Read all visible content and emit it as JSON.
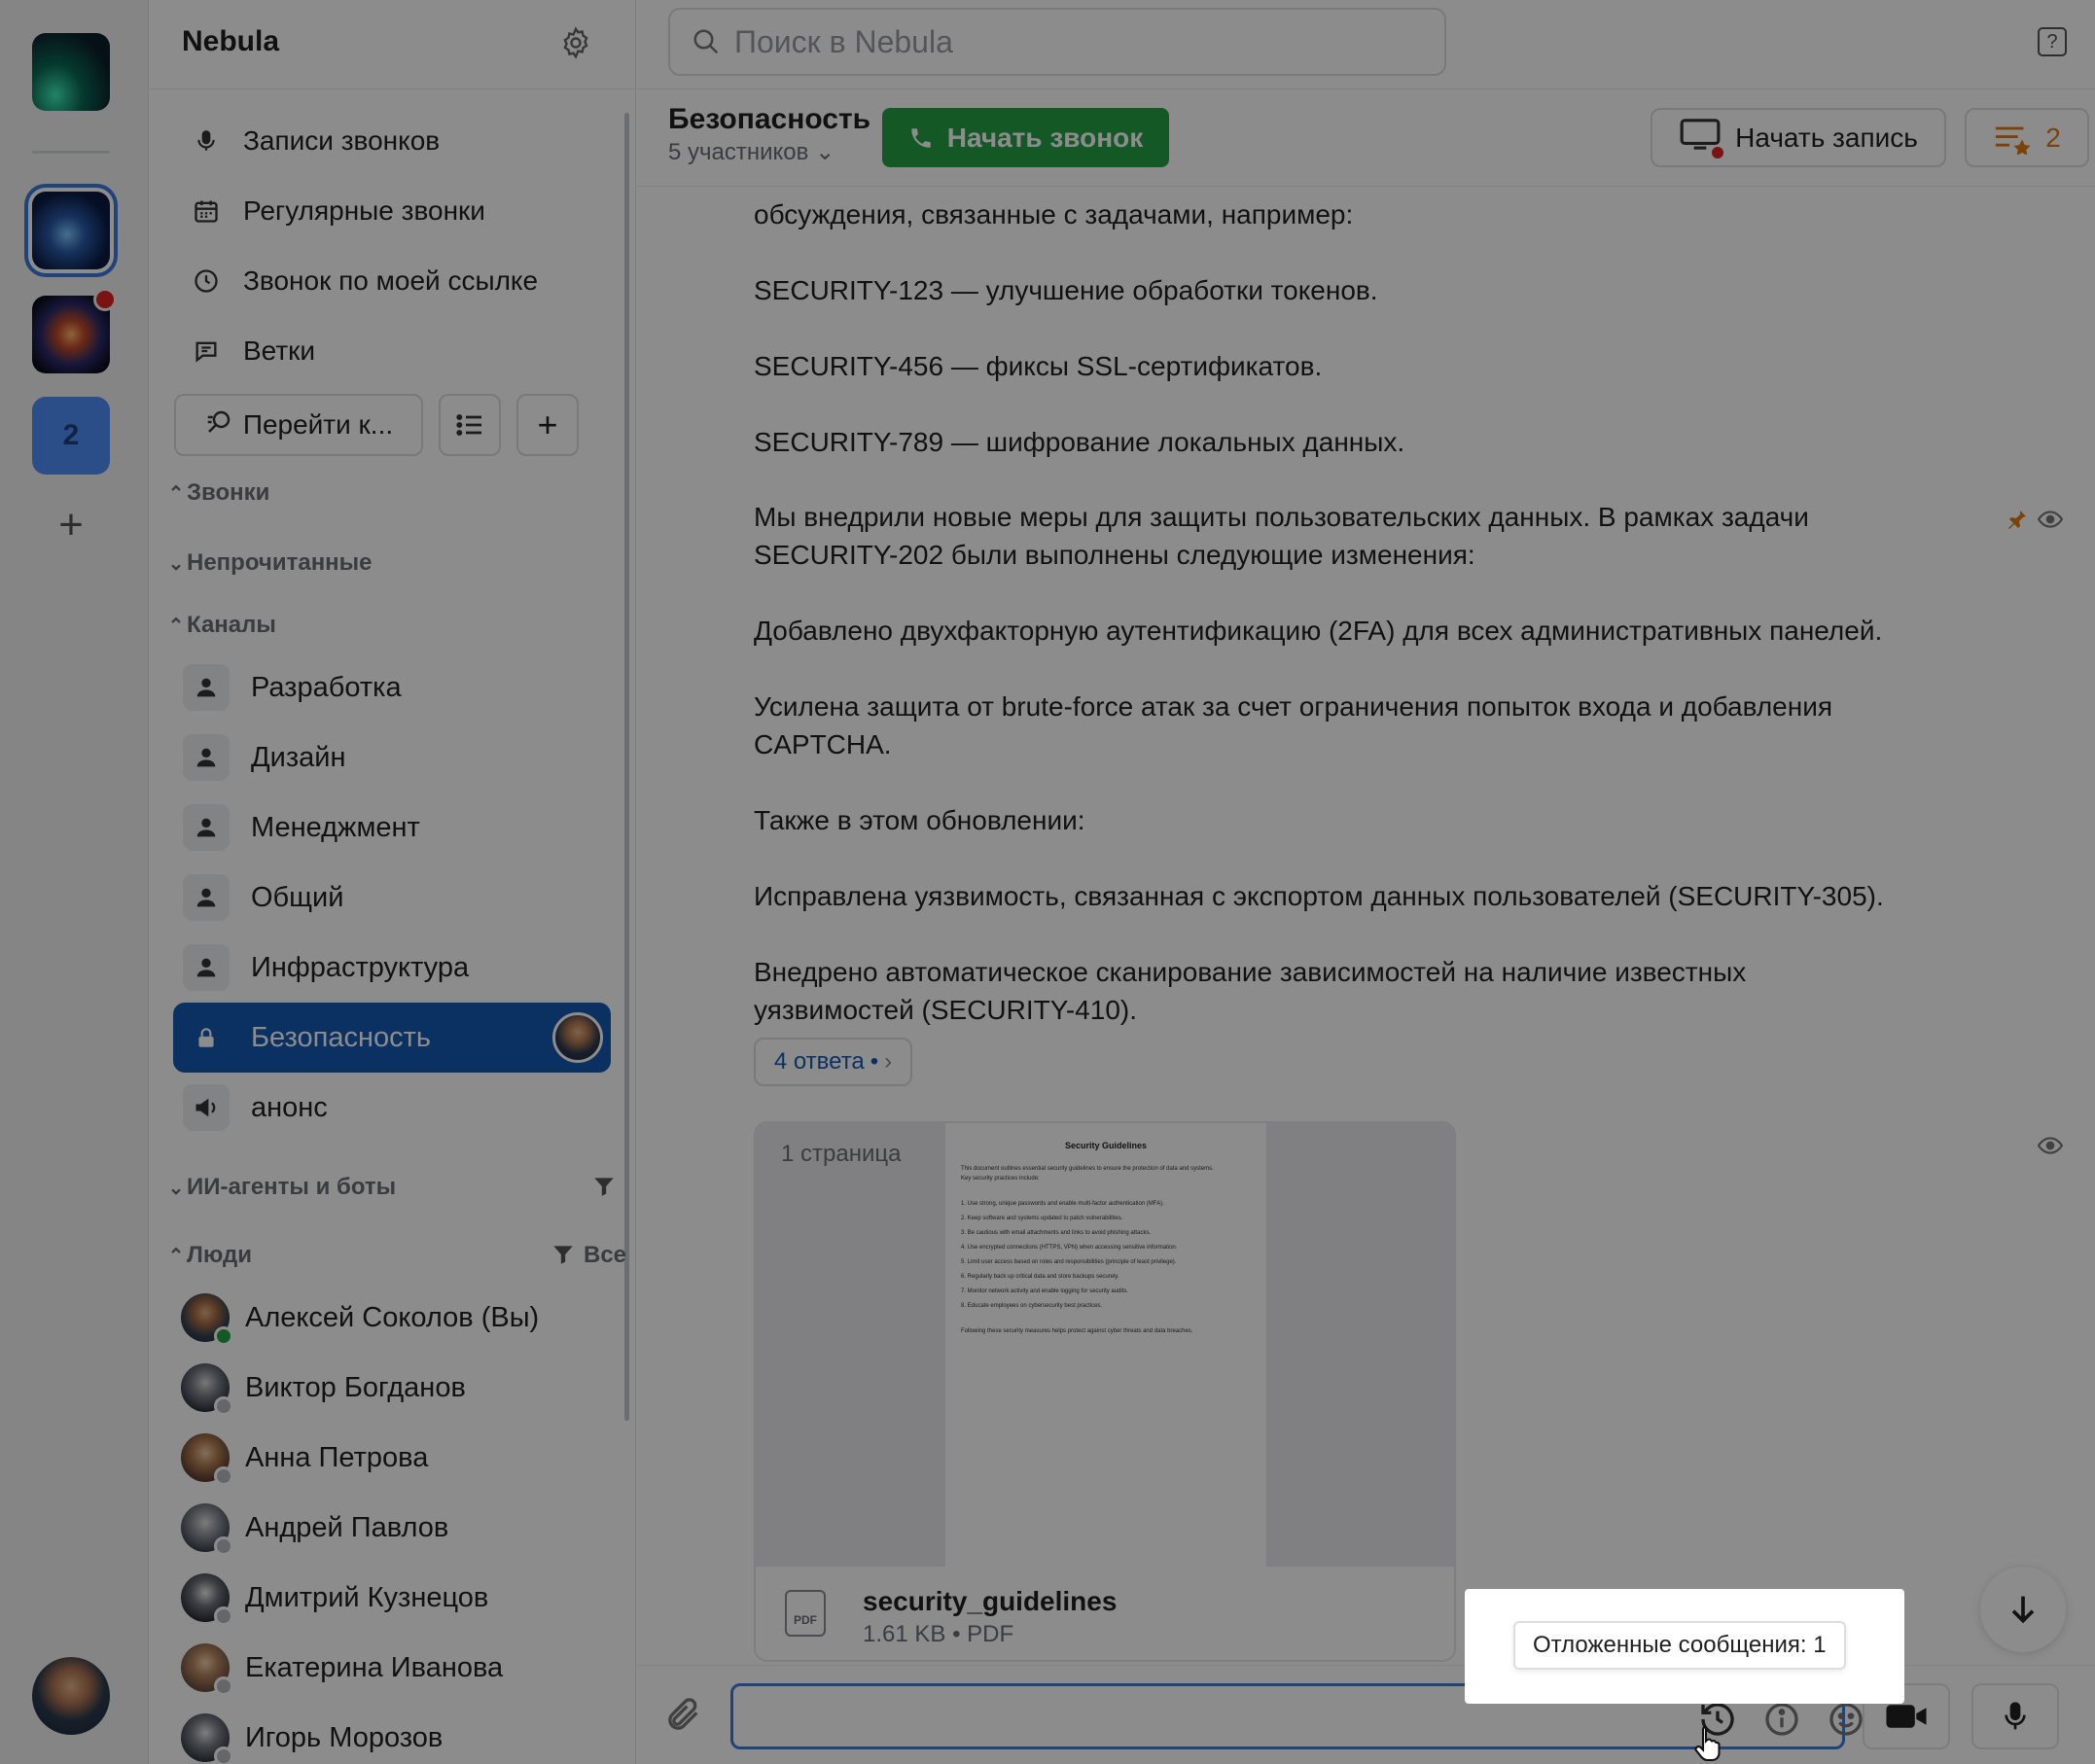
{
  "workspace": {
    "name": "Nebula",
    "rail_badge": "2"
  },
  "sidebar": {
    "nav": [
      {
        "label": "Записи звонков",
        "icon": "microphone-icon"
      },
      {
        "label": "Регулярные звонки",
        "icon": "calendar-icon"
      },
      {
        "label": "Звонок по моей ссылке",
        "icon": "clock-icon"
      },
      {
        "label": "Ветки",
        "icon": "thread-icon"
      }
    ],
    "goto_label": "Перейти к...",
    "sections": {
      "calls": "Звонки",
      "unread": "Непрочитанные",
      "channels": "Каналы",
      "ai": "ИИ-агенты и боты",
      "people": "Люди",
      "people_filter": "Все"
    },
    "channels": [
      {
        "label": "Разработка",
        "icon": "group-icon"
      },
      {
        "label": "Дизайн",
        "icon": "group-icon"
      },
      {
        "label": "Менеджмент",
        "icon": "group-icon"
      },
      {
        "label": "Общий",
        "icon": "group-icon"
      },
      {
        "label": "Инфраструктура",
        "icon": "group-icon"
      },
      {
        "label": "Безопасность",
        "icon": "lock-icon",
        "active": true
      },
      {
        "label": "анонс",
        "icon": "megaphone-icon"
      }
    ],
    "people": [
      {
        "name": "Алексей Соколов (Вы)",
        "online": true
      },
      {
        "name": "Виктор Богданов",
        "online": false
      },
      {
        "name": "Анна Петрова",
        "online": false
      },
      {
        "name": "Андрей Павлов",
        "online": false
      },
      {
        "name": "Дмитрий Кузнецов",
        "online": false
      },
      {
        "name": "Екатерина Иванова",
        "online": false
      },
      {
        "name": "Игорь Морозов",
        "online": false
      }
    ]
  },
  "search": {
    "placeholder": "Поиск в Nebula"
  },
  "channel": {
    "title": "Безопасность",
    "members": "5 участников",
    "call_label": "Начать звонок",
    "record_label": "Начать запись",
    "pinned_count": "2"
  },
  "messages": {
    "lines": [
      "обсуждения, связанные с задачами, например:",
      "SECURITY-123 — улучшение обработки токенов.",
      "SECURITY-456 — фиксы SSL-сертификатов.",
      "SECURITY-789 — шифрование локальных данных.",
      "Мы внедрили новые меры для защиты пользовательских данных. В рамках задачи",
      "SECURITY-202 были выполнены следующие изменения:",
      "Добавлено двухфакторную аутентификацию (2FA) для всех административных панелей.",
      "Усилена защита от brute-force атак за счет ограничения попыток входа и добавления",
      "CAPTCHA.",
      "Также в этом обновлении:",
      "Исправлена уязвимость, связанная с экспортом данных пользователей (SECURITY-305).",
      "Внедрено автоматическое сканирование зависимостей на наличие известных",
      "уязвимостей (SECURITY-410)."
    ],
    "replies_label": "4 ответа",
    "replies_dot": "•"
  },
  "attachment": {
    "page_count": "1 страница",
    "file_name": "security_guidelines",
    "file_meta": "1.61 KB • PDF",
    "type_label": "PDF",
    "preview": {
      "title": "Security Guidelines",
      "lines": [
        "This document outlines essential security guidelines to ensure the protection of data and systems.",
        "Key security practices include:",
        "1. Use strong, unique passwords and enable multi-factor authentication (MFA).",
        "2. Keep software and systems updated to patch vulnerabilities.",
        "3. Be cautious with email attachments and links to avoid phishing attacks.",
        "4. Use encrypted connections (HTTPS, VPN) when accessing sensitive information.",
        "5. Limit user access based on roles and responsibilities (principle of least privilege).",
        "6. Regularly back up critical data and store backups securely.",
        "7. Monitor network activity and enable logging for security audits.",
        "8. Educate employees on cybersecurity best practices.",
        "Following these security measures helps protect against cyber threats and data breaches."
      ]
    }
  },
  "composer": {
    "tooltip": "Отложенные сообщения: 1"
  }
}
